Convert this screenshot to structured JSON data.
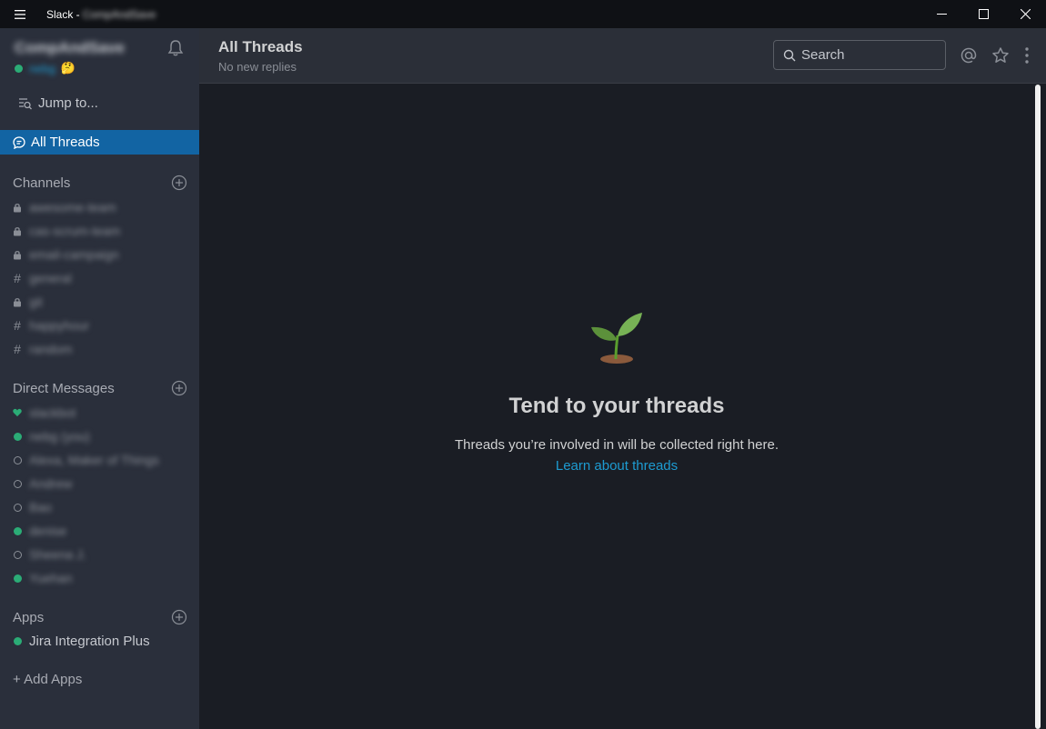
{
  "window": {
    "title": "Slack - ",
    "title_blurred": "CompAndSave"
  },
  "sidebar": {
    "team_name": "CompAndSave",
    "user_name": "nebg",
    "jump_to": "Jump to...",
    "all_threads": "All Threads",
    "channels_header": "Channels",
    "channels": [
      {
        "prefix": "lock",
        "name": "awesome-team"
      },
      {
        "prefix": "lock",
        "name": "cas-scrum-team"
      },
      {
        "prefix": "lock",
        "name": "email-campaign"
      },
      {
        "prefix": "#",
        "name": "general"
      },
      {
        "prefix": "lock",
        "name": "git"
      },
      {
        "prefix": "#",
        "name": "happyhour"
      },
      {
        "prefix": "#",
        "name": "random"
      }
    ],
    "dm_header": "Direct Messages",
    "dms": [
      {
        "status": "heart",
        "name": "slackbot"
      },
      {
        "status": "online",
        "name": "nebg (you)"
      },
      {
        "status": "away",
        "name": "Alexa, Maker of Things"
      },
      {
        "status": "away",
        "name": "Andrew"
      },
      {
        "status": "away",
        "name": "Bao"
      },
      {
        "status": "online",
        "name": "denise"
      },
      {
        "status": "away",
        "name": "Sheena J."
      },
      {
        "status": "online",
        "name": "Yuehan"
      }
    ],
    "apps_header": "Apps",
    "apps": [
      {
        "status": "online",
        "name": "Jira Integration Plus"
      }
    ],
    "add_apps": "+ Add Apps"
  },
  "header": {
    "title": "All Threads",
    "subtitle": "No new replies",
    "search_placeholder": "Search"
  },
  "empty_state": {
    "title": "Tend to your threads",
    "description": "Threads you’re involved in will be collected right here.",
    "link": "Learn about threads"
  },
  "colors": {
    "accent": "#1264a3",
    "online": "#2bac76",
    "link": "#1d9bd1"
  }
}
